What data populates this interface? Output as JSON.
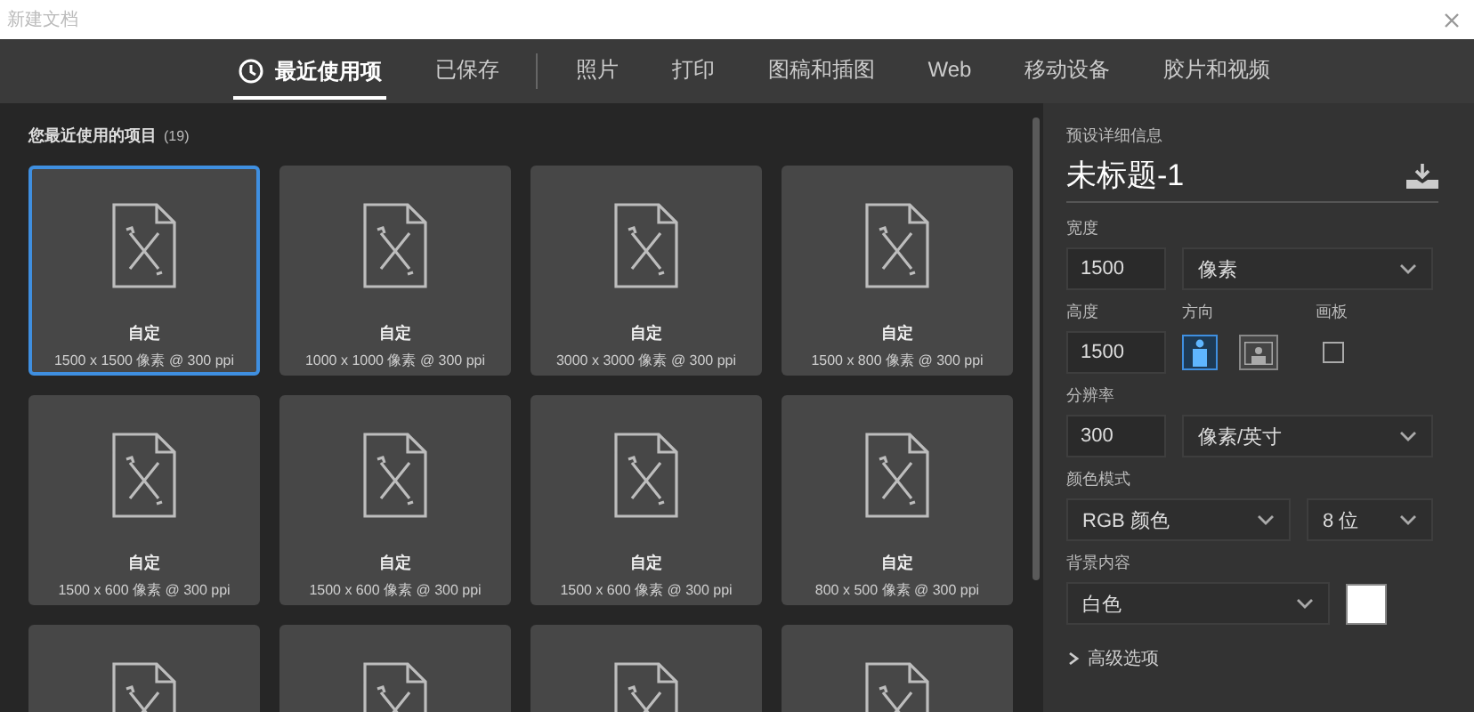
{
  "window": {
    "title": "新建文档"
  },
  "tabs": [
    {
      "label": "最近使用项",
      "selected": true,
      "kind": "recent",
      "divider_after": false
    },
    {
      "label": "已保存",
      "selected": false,
      "divider_after": true
    },
    {
      "label": "照片",
      "selected": false,
      "divider_after": false
    },
    {
      "label": "打印",
      "selected": false,
      "divider_after": false
    },
    {
      "label": "图稿和插图",
      "selected": false,
      "divider_after": false
    },
    {
      "label": "Web",
      "selected": false,
      "divider_after": false
    },
    {
      "label": "移动设备",
      "selected": false,
      "divider_after": false
    },
    {
      "label": "胶片和视频",
      "selected": false,
      "divider_after": false
    }
  ],
  "recent": {
    "heading": "您最近使用的项目",
    "count": "(19)",
    "presets": [
      {
        "kind": "full",
        "name": "自定",
        "size": "1500 x 1500 像素 @ 300 ppi",
        "selected": true
      },
      {
        "kind": "full",
        "name": "自定",
        "size": "1000 x 1000 像素 @ 300 ppi",
        "selected": false
      },
      {
        "kind": "full",
        "name": "自定",
        "size": "3000 x 3000 像素 @ 300 ppi",
        "selected": false
      },
      {
        "kind": "full",
        "name": "自定",
        "size": "1500 x 800 像素 @ 300 ppi",
        "selected": false
      },
      {
        "kind": "full",
        "name": "自定",
        "size": "1500 x 600 像素 @ 300 ppi",
        "selected": false
      },
      {
        "kind": "full",
        "name": "自定",
        "size": "1500 x 600 像素 @ 300 ppi",
        "selected": false
      },
      {
        "kind": "full",
        "name": "自定",
        "size": "1500 x 600 像素 @ 300 ppi",
        "selected": false
      },
      {
        "kind": "full",
        "name": "自定",
        "size": "800 x 500 像素 @ 300 ppi",
        "selected": false
      },
      {
        "kind": "cut",
        "selected": false
      },
      {
        "kind": "cut",
        "selected": false
      },
      {
        "kind": "cut",
        "selected": false
      },
      {
        "kind": "cut",
        "selected": false
      }
    ]
  },
  "details": {
    "heading": "预设详细信息",
    "document_name": "未标题-1",
    "width": {
      "label": "宽度",
      "value": "1500",
      "unit": "像素"
    },
    "height": {
      "label": "高度",
      "value": "1500"
    },
    "orientation": {
      "label": "方向",
      "options": [
        {
          "kind": "portrait",
          "selected": true
        },
        {
          "kind": "landscape",
          "selected": false
        }
      ]
    },
    "artboards": {
      "label": "画板",
      "checked": false
    },
    "resolution": {
      "label": "分辨率",
      "value": "300",
      "unit": "像素/英寸"
    },
    "color_mode": {
      "label": "颜色模式",
      "mode": "RGB 颜色",
      "depth": "8 位"
    },
    "background": {
      "label": "背景内容",
      "value": "白色",
      "color": "#ffffff"
    },
    "advanced": {
      "label": "高级选项",
      "expanded": false
    }
  }
}
